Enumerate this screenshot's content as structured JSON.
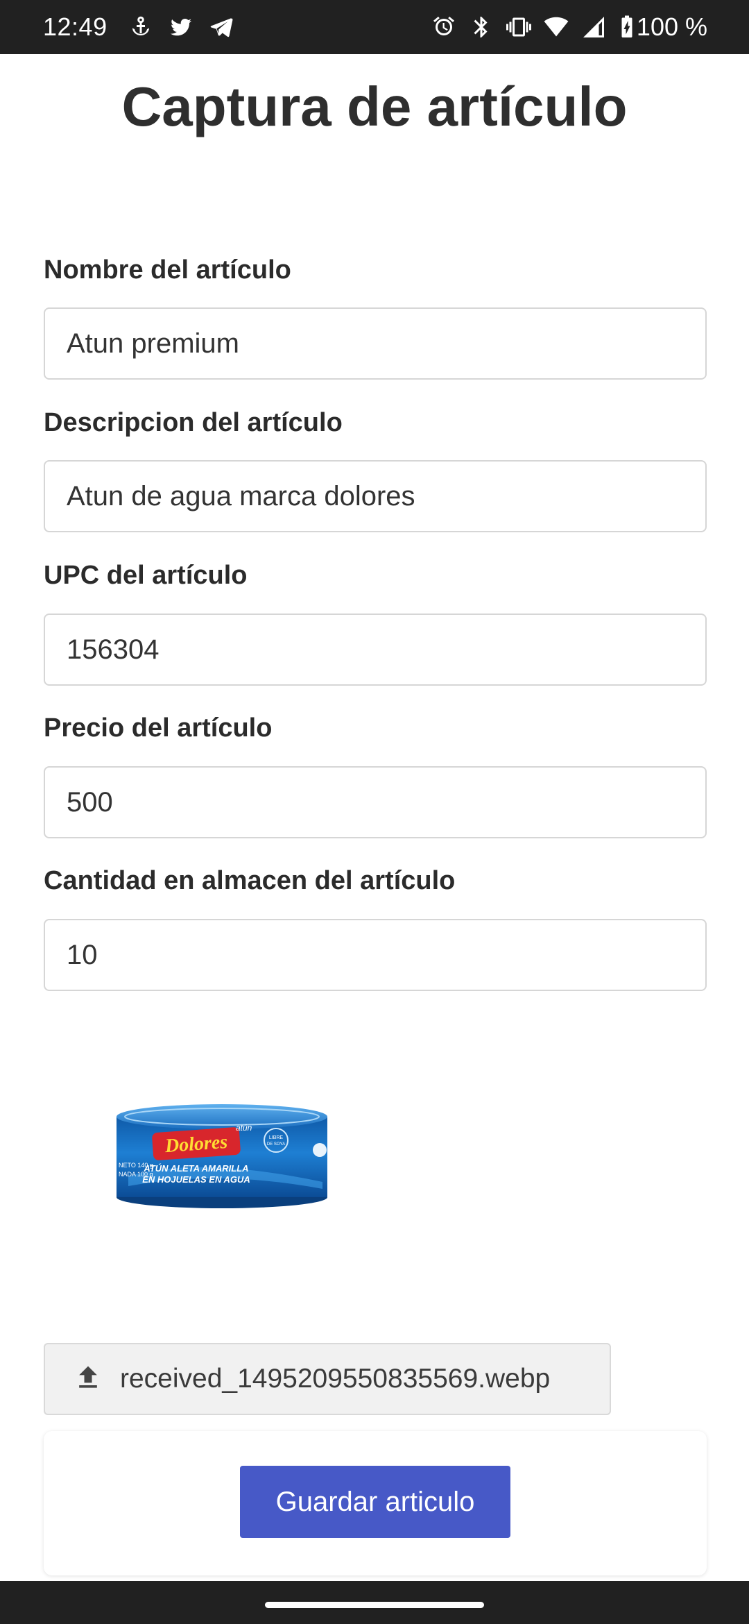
{
  "status_bar": {
    "time": "12:49",
    "left_icons": [
      "anchor-icon",
      "twitter-icon",
      "telegram-icon"
    ],
    "right_icons": [
      "alarm-icon",
      "bluetooth-icon",
      "vibrate-icon",
      "wifi-icon",
      "signal-icon",
      "battery-charging-icon"
    ],
    "battery_text": "100 %"
  },
  "page": {
    "title": "Captura de artículo"
  },
  "form": {
    "name_label": "Nombre del artículo",
    "name_value": "Atun premium",
    "description_label": "Descripcion del artículo",
    "description_value": "Atun de agua marca dolores",
    "upc_label": "UPC del artículo",
    "upc_value": "156304",
    "price_label": "Precio del artículo",
    "price_value": "500",
    "stock_label": "Cantidad en almacen del artículo",
    "stock_value": "10"
  },
  "product_image": {
    "brand": "Dolores",
    "brand_small": "atún",
    "line1": "ATÚN ALETA AMARILLA",
    "line2": "EN HOJUELAS EN AGUA",
    "left_line1": "NETO 140 g",
    "left_line2": "NADA 100 g",
    "badge_line1": "LIBRE",
    "badge_line2": "DE SOYA"
  },
  "file_upload": {
    "icon": "upload-icon",
    "file_name": "received_1495209550835569.webp"
  },
  "actions": {
    "save_label": "Guardar articulo"
  },
  "colors": {
    "primary_button": "#4759c7",
    "status_bar": "#212121",
    "can_blue": "#1e73c8",
    "brand_red": "#d8262c"
  }
}
